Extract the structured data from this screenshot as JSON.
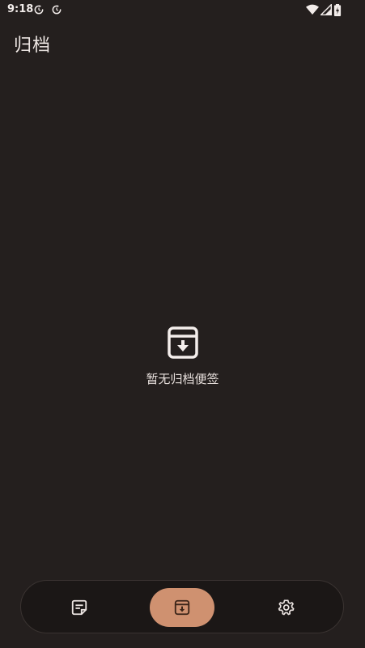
{
  "status_bar": {
    "time": "9:18"
  },
  "header": {
    "title": "归档"
  },
  "empty_state": {
    "message": "暂无归档便签",
    "icon": "archive-icon"
  },
  "bottom_nav": {
    "items": [
      {
        "icon": "note-icon",
        "active": false
      },
      {
        "icon": "archive-icon",
        "active": true
      },
      {
        "icon": "gear-icon",
        "active": false
      }
    ]
  },
  "colors": {
    "background": "#241f1e",
    "nav_background": "#1b1716",
    "accent": "#cf9170",
    "text": "#e9e2df"
  }
}
